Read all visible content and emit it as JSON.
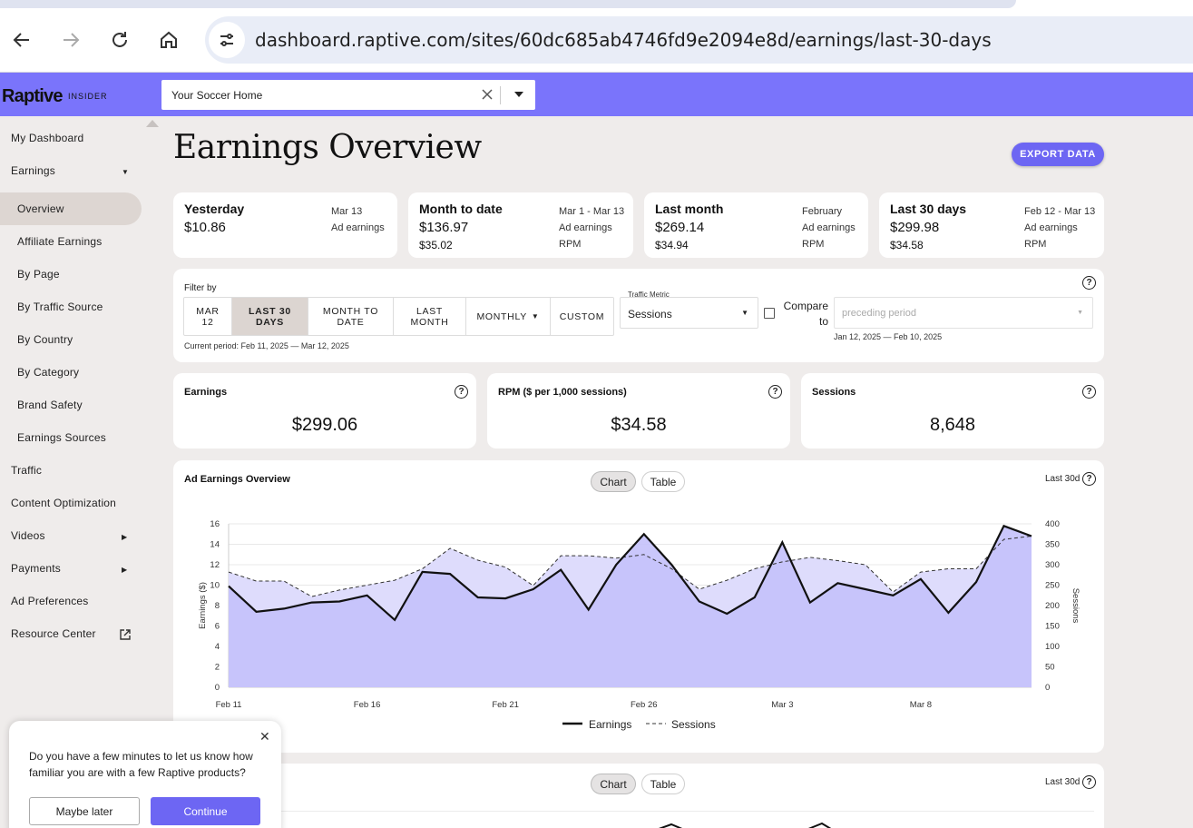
{
  "browser": {
    "url": "dashboard.raptive.com/sites/60dc685ab4746fd9e2094e8d/earnings/last-30-days"
  },
  "app": {
    "brand": "Raptive",
    "brand_sub": "INSIDER",
    "site_select": "Your Soccer Home"
  },
  "sidebar": {
    "my_dashboard": "My Dashboard",
    "earnings": "Earnings",
    "sub_items": [
      "Overview",
      "Affiliate Earnings",
      "By Page",
      "By Traffic Source",
      "By Country",
      "By Category",
      "Brand Safety",
      "Earnings Sources"
    ],
    "items": [
      "Traffic",
      "Content Optimization",
      "Videos",
      "Payments",
      "Ad Preferences",
      "Resource Center"
    ]
  },
  "page": {
    "title": "Earnings Overview",
    "export_label": "EXPORT DATA"
  },
  "summary": [
    {
      "label": "Yesterday",
      "value": "$10.86",
      "value2": "",
      "date": "Mar 13",
      "r2": "Ad earnings",
      "r3": ""
    },
    {
      "label": "Month to date",
      "value": "$136.97",
      "value2": "$35.02",
      "date": "Mar 1 - Mar 13",
      "r2": "Ad earnings",
      "r3": "RPM"
    },
    {
      "label": "Last month",
      "value": "$269.14",
      "value2": "$34.94",
      "date": "February",
      "r2": "Ad earnings",
      "r3": "RPM"
    },
    {
      "label": "Last 30 days",
      "value": "$299.98",
      "value2": "$34.58",
      "date": "Feb 12 - Mar 13",
      "r2": "Ad earnings",
      "r3": "RPM"
    }
  ],
  "filter": {
    "label": "Filter by",
    "buttons": [
      "MAR 12",
      "LAST 30 DAYS",
      "MONTH TO DATE",
      "LAST MONTH",
      "MONTHLY",
      "CUSTOM"
    ],
    "active": "LAST 30 DAYS",
    "current_period": "Current period: Feb 11, 2025 — Mar 12, 2025",
    "traffic_metric_label": "Traffic Metric",
    "traffic_metric_value": "Sessions",
    "compare_label": "Compare to",
    "compare_placeholder": "preceding period",
    "compare_range": "Jan 12, 2025 — Feb 10, 2025"
  },
  "metrics": [
    {
      "label": "Earnings",
      "value": "$299.06"
    },
    {
      "label": "RPM ($ per 1,000 sessions)",
      "value": "$34.58"
    },
    {
      "label": "Sessions",
      "value": "8,648"
    }
  ],
  "chart_panel": {
    "title": "Ad Earnings Overview",
    "toggle": [
      "Chart",
      "Table"
    ],
    "range": "Last 30d"
  },
  "second_panel": {
    "toggle": [
      "Chart",
      "Table"
    ],
    "range": "Last 30d"
  },
  "chart_data": {
    "type": "line",
    "x": [
      "Feb 11",
      "Feb 12",
      "Feb 13",
      "Feb 14",
      "Feb 15",
      "Feb 16",
      "Feb 17",
      "Feb 18",
      "Feb 19",
      "Feb 20",
      "Feb 21",
      "Feb 22",
      "Feb 23",
      "Feb 24",
      "Feb 25",
      "Feb 26",
      "Feb 27",
      "Feb 28",
      "Mar 1",
      "Mar 2",
      "Mar 3",
      "Mar 4",
      "Mar 5",
      "Mar 6",
      "Mar 7",
      "Mar 8",
      "Mar 9",
      "Mar 10",
      "Mar 11",
      "Mar 12"
    ],
    "xticks": [
      "Feb 11",
      "Feb 16",
      "Feb 21",
      "Feb 26",
      "Mar 3",
      "Mar 8"
    ],
    "series": [
      {
        "name": "Earnings",
        "axis": "left",
        "style": "solid",
        "color": "#111111",
        "values": [
          9.9,
          7.4,
          7.7,
          8.3,
          8.4,
          9.0,
          6.6,
          11.3,
          11.1,
          8.8,
          8.7,
          9.6,
          11.5,
          7.6,
          12.0,
          15.0,
          12.0,
          8.4,
          7.2,
          8.8,
          14.2,
          8.3,
          10.2,
          9.6,
          9.0,
          10.6,
          7.3,
          10.3,
          15.8,
          14.8
        ]
      },
      {
        "name": "Sessions",
        "axis": "right",
        "style": "dashed",
        "color": "#333333",
        "values": [
          282,
          260,
          260,
          222,
          238,
          250,
          262,
          290,
          340,
          311,
          294,
          249,
          322,
          322,
          316,
          325,
          290,
          240,
          262,
          290,
          307,
          318,
          310,
          300,
          233,
          282,
          290,
          290,
          362,
          370
        ]
      }
    ],
    "ylabel": "Earnings ($)",
    "y2label": "Sessions",
    "ylim": [
      0,
      16
    ],
    "y2lim": [
      0,
      400
    ],
    "yticks": [
      0,
      2,
      4,
      6,
      8,
      10,
      12,
      14,
      16
    ],
    "y2ticks": [
      0,
      50,
      100,
      150,
      200,
      250,
      300,
      350,
      400
    ],
    "legend": "bottom-center",
    "grid": true,
    "fill_color": "#c4c1fb",
    "fill_color_sessions": "#dedcfc"
  },
  "survey": {
    "text": "Do you have a few minutes to let us know how familiar you are with a few Raptive products?",
    "later": "Maybe later",
    "continue": "Continue"
  }
}
